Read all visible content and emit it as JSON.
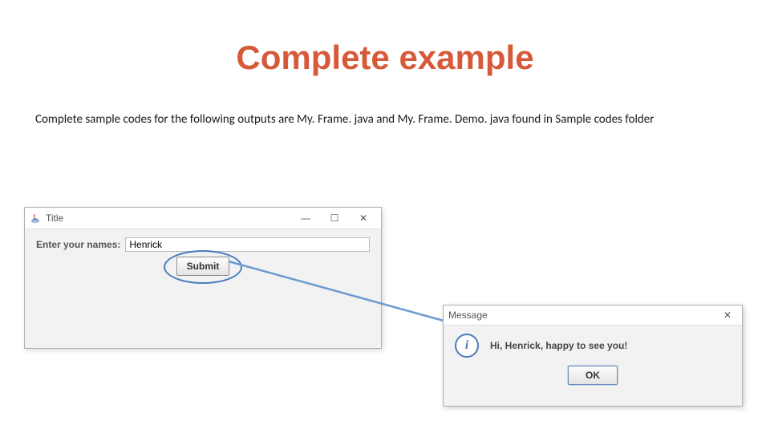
{
  "slide": {
    "title": "Complete example",
    "description": "Complete sample codes for the following outputs are My. Frame. java and My. Frame. Demo. java found in Sample codes folder"
  },
  "frame": {
    "window_title": "Title",
    "form": {
      "label": "Enter your names:",
      "input_value": "Henrick",
      "submit_label": "Submit"
    },
    "controls": {
      "minimize_glyph": "—",
      "maximize_glyph": "☐",
      "close_glyph": "✕"
    }
  },
  "dialog": {
    "window_title": "Message",
    "close_glyph": "✕",
    "info_glyph": "i",
    "message": "Hi, Henrick, happy to see you!",
    "ok_label": "OK"
  }
}
